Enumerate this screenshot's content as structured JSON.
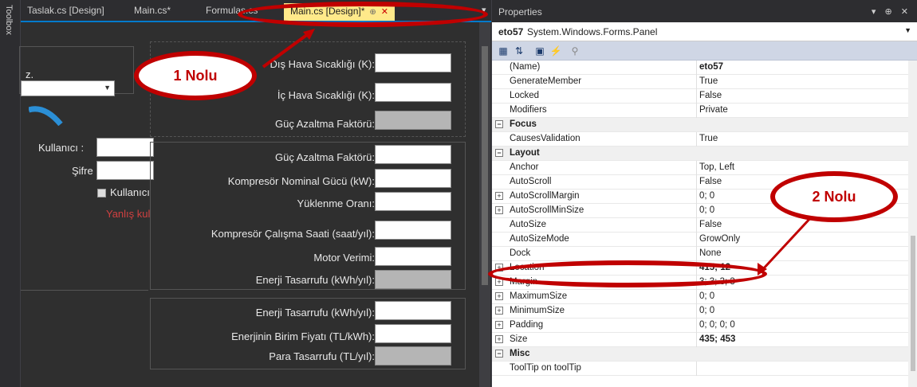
{
  "toolbox": {
    "label": "Toolbox"
  },
  "tabs": [
    {
      "label": "Taslak.cs [Design]"
    },
    {
      "label": "Main.cs*"
    },
    {
      "label": "Formulas.cs"
    },
    {
      "label": "Main.cs [Design]*"
    }
  ],
  "tab_pin_glyph": "⊕",
  "tab_close_glyph": "✕",
  "tab_overflow_glyph": "▾",
  "designer": {
    "left_label_fragment": "z.",
    "kullanici_label": "Kullanıcı :",
    "sifre_label": "Şifre :",
    "remember_label": "Kullanıcı",
    "error_fragment": "Yanlış kul",
    "group1": [
      {
        "label": "Dış Hava Sıcaklığı (K):",
        "readonly": false
      },
      {
        "label": "İç Hava Sıcaklığı (K):",
        "readonly": false
      },
      {
        "label": "Güç Azaltma Faktörü:",
        "readonly": true
      }
    ],
    "group2": [
      {
        "label": "Güç Azaltma Faktörü:",
        "readonly": false
      },
      {
        "label": "Kompresör Nominal Gücü (kW):",
        "readonly": false
      },
      {
        "label": "Yüklenme Oranı:",
        "readonly": false
      },
      {
        "label": "Kompresör Çalışma Saati (saat/yıl):",
        "readonly": false
      },
      {
        "label": "Motor Verimi:",
        "readonly": false
      },
      {
        "label": "Enerji Tasarrufu (kWh/yıl):",
        "readonly": true
      }
    ],
    "group3": [
      {
        "label": "Enerji Tasarrufu (kWh/yıl):",
        "readonly": false
      },
      {
        "label": "Enerjinin Birim Fiyatı (TL/kWh):",
        "readonly": false
      },
      {
        "label": "Para Tasarrufu (TL/yıl):",
        "readonly": true
      }
    ]
  },
  "properties": {
    "title": "Properties",
    "header_controls": "▾ ⊕ ✕",
    "object_name": "eto57",
    "object_type": "System.Windows.Forms.Panel",
    "rows": [
      {
        "kind": "prop",
        "name": "(Name)",
        "value": "eto57",
        "bold": true,
        "expandable": false
      },
      {
        "kind": "prop",
        "name": "GenerateMember",
        "value": "True",
        "bold": false,
        "expandable": false
      },
      {
        "kind": "prop",
        "name": "Locked",
        "value": "False",
        "bold": false,
        "expandable": false
      },
      {
        "kind": "prop",
        "name": "Modifiers",
        "value": "Private",
        "bold": false,
        "expandable": false
      },
      {
        "kind": "cat",
        "name": "Focus"
      },
      {
        "kind": "prop",
        "name": "CausesValidation",
        "value": "True",
        "bold": false,
        "expandable": false
      },
      {
        "kind": "cat",
        "name": "Layout"
      },
      {
        "kind": "prop",
        "name": "Anchor",
        "value": "Top, Left",
        "bold": false,
        "expandable": false
      },
      {
        "kind": "prop",
        "name": "AutoScroll",
        "value": "False",
        "bold": false,
        "expandable": false
      },
      {
        "kind": "prop",
        "name": "AutoScrollMargin",
        "value": "0; 0",
        "bold": false,
        "expandable": true
      },
      {
        "kind": "prop",
        "name": "AutoScrollMinSize",
        "value": "0; 0",
        "bold": false,
        "expandable": true
      },
      {
        "kind": "prop",
        "name": "AutoSize",
        "value": "False",
        "bold": false,
        "expandable": false
      },
      {
        "kind": "prop",
        "name": "AutoSizeMode",
        "value": "GrowOnly",
        "bold": false,
        "expandable": false
      },
      {
        "kind": "prop",
        "name": "Dock",
        "value": "None",
        "bold": false,
        "expandable": false
      },
      {
        "kind": "prop",
        "name": "Location",
        "value": "415; 12",
        "bold": true,
        "expandable": true
      },
      {
        "kind": "prop",
        "name": "Margin",
        "value": "3; 3; 3; 3",
        "bold": false,
        "expandable": true
      },
      {
        "kind": "prop",
        "name": "MaximumSize",
        "value": "0; 0",
        "bold": false,
        "expandable": true
      },
      {
        "kind": "prop",
        "name": "MinimumSize",
        "value": "0; 0",
        "bold": false,
        "expandable": true
      },
      {
        "kind": "prop",
        "name": "Padding",
        "value": "0; 0; 0; 0",
        "bold": false,
        "expandable": true
      },
      {
        "kind": "prop",
        "name": "Size",
        "value": "435; 453",
        "bold": true,
        "expandable": true
      },
      {
        "kind": "cat",
        "name": "Misc"
      },
      {
        "kind": "prop",
        "name": "ToolTip on toolTip",
        "value": "",
        "bold": false,
        "expandable": false
      }
    ]
  },
  "annotations": {
    "callout1": "1 Nolu",
    "callout2": "2 Nolu"
  },
  "colors": {
    "annotation_red": "#c00000",
    "active_tab": "#ffe98a",
    "accent_blue": "#007acc"
  }
}
